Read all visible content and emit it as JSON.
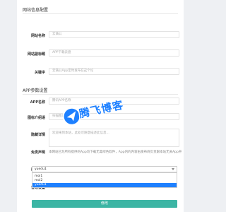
{
  "site_section": {
    "title": "网站信息配置",
    "fields": [
      {
        "label": "网站名称",
        "placeholder": "云满公"
      },
      {
        "label": "网站副标题",
        "placeholder": "APP下载云盘"
      },
      {
        "label": "关键字",
        "placeholder": "云满公App定时发布在这个论"
      }
    ]
  },
  "app_section": {
    "title": "APP参数设置",
    "fields": [
      {
        "label": "APP名称",
        "placeholder": "腾讯APP名称"
      },
      {
        "label": "图标介绍语",
        "placeholder": "扫描图片介绍"
      },
      {
        "label": "隐藏详情",
        "placeholder": "欢迎来到本站，此处可随意描述此信息..."
      }
    ],
    "notice_label": "免责声明",
    "notice_text": "本网站已为所有提供的App均下载无毒绿色软件，App内的内容由发布商负责跟本站无关App开",
    "version_label": "应用模板",
    "version_selected": "yuedu1",
    "version_options": [
      "moi1",
      "moi2",
      "yuedu1"
    ],
    "next_label": "音效设置"
  },
  "save_label": "修改",
  "watermark": {
    "text": "腾飞博客"
  },
  "colors": {
    "accent": "#3cb5a4",
    "selection": "#1e80ff",
    "background": "#eef0f3"
  }
}
